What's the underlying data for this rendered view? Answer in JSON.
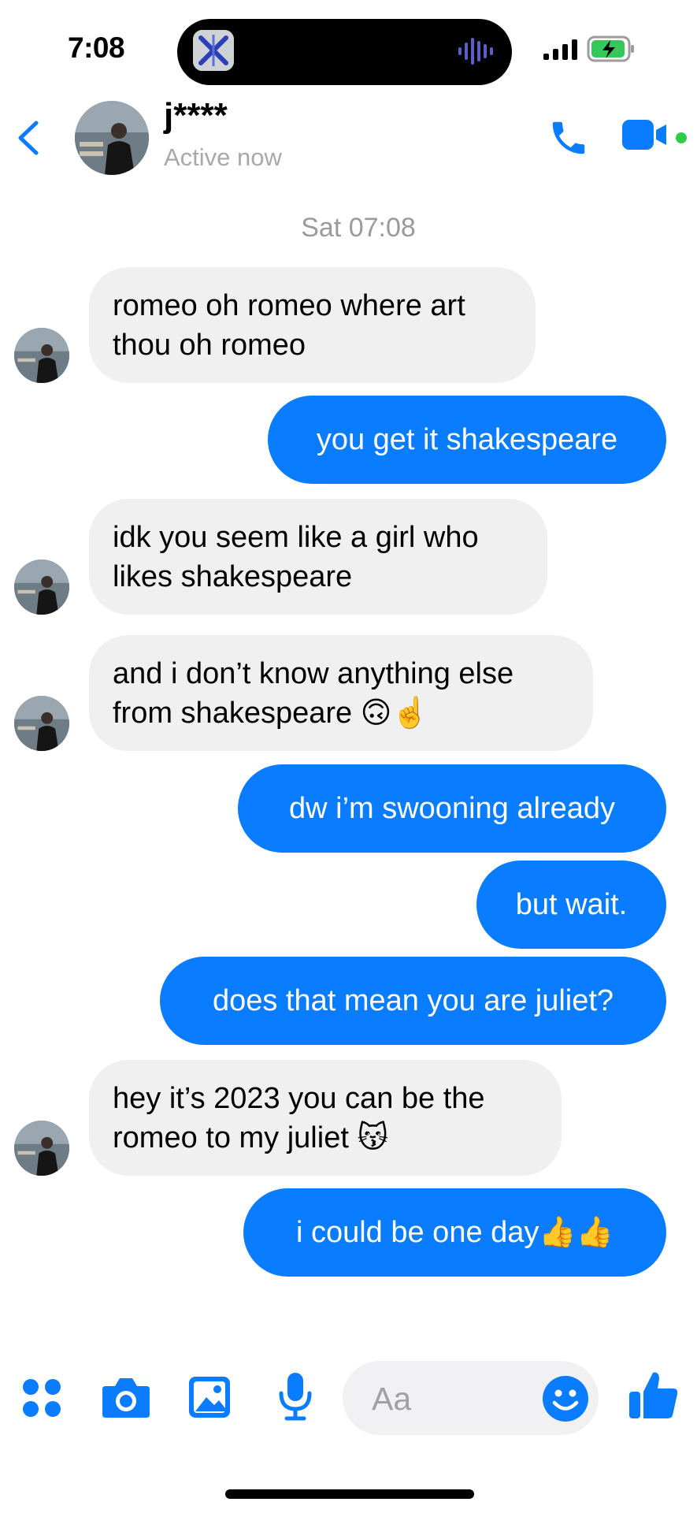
{
  "status_bar": {
    "time": "7:08"
  },
  "header": {
    "contact_name": "j****",
    "contact_status": "Active now",
    "accent_color": "#0a7cff",
    "active_color": "#31cc46"
  },
  "thread": {
    "date_separator": "Sat 07:08",
    "messages": [
      {
        "sender": "them",
        "text": "romeo oh romeo where art thou oh romeo"
      },
      {
        "sender": "me",
        "text": "you get it shakespeare"
      },
      {
        "sender": "them",
        "text": "idk you seem like a girl who likes shakespeare"
      },
      {
        "sender": "them",
        "text": "and i don’t know anything else from shakespeare 🙃☝️"
      },
      {
        "sender": "me",
        "text": "dw i’m swooning already"
      },
      {
        "sender": "me",
        "text": "but wait."
      },
      {
        "sender": "me",
        "text": "does that mean you are juliet?"
      },
      {
        "sender": "them",
        "text": "hey it’s 2023 you can be the romeo to my juliet 😽"
      },
      {
        "sender": "me",
        "text": "i could be one day👍👍"
      }
    ]
  },
  "composer": {
    "placeholder": "Aa",
    "icons": [
      "apps-icon",
      "camera-icon",
      "gallery-icon",
      "microphone-icon",
      "emoji-icon",
      "thumbs-up-icon"
    ]
  }
}
